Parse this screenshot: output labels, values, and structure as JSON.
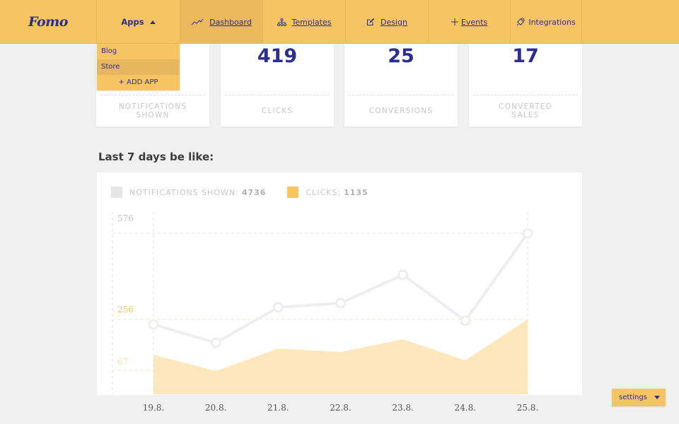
{
  "nav": {
    "logo": "Fomo",
    "apps_label": "Apps",
    "items": [
      {
        "label": "Dashboard",
        "icon": "trend-line-icon",
        "active": true
      },
      {
        "label": "Templates",
        "icon": "sitemap-icon"
      },
      {
        "label": "Design",
        "icon": "edit-icon"
      },
      {
        "label": "Events",
        "icon": "plus-icon"
      },
      {
        "label": "Integrations",
        "icon": "plug-icon"
      }
    ]
  },
  "apps_dropdown": {
    "items": [
      "Blog",
      "Store"
    ],
    "add_label": "+ ADD APP"
  },
  "stats": [
    {
      "value": "",
      "label": "NOTIFICATIONS SHOWN"
    },
    {
      "value": "419",
      "label": "CLICKS"
    },
    {
      "value": "25",
      "label": "CONVERSIONS"
    },
    {
      "value": "17",
      "label": "CONVERTED SALES"
    }
  ],
  "section_title": "Last 7 days be like:",
  "legend": [
    {
      "label": "NOTIFICATIONS SHOWN:",
      "value": "4736",
      "color": "#e6e6e6"
    },
    {
      "label": "CLICKS:",
      "value": "1135",
      "color": "#f7c463"
    }
  ],
  "settings_label": "settings",
  "chart_data": {
    "type": "line",
    "title": "Last 7 days be like:",
    "categories": [
      "19.8.",
      "20.8.",
      "21.8.",
      "22.8.",
      "23.8.",
      "24.8.",
      "25.8."
    ],
    "series": [
      {
        "name": "Notifications shown",
        "style": "line",
        "color": "#eeeeee",
        "values": [
          250,
          184,
          311,
          326,
          427,
          263,
          576
        ],
        "total": 4736,
        "ylim": [
          0,
          576
        ],
        "axis_labels": [
          "576"
        ]
      },
      {
        "name": "Clicks",
        "style": "area",
        "color": "#fde8be",
        "values": [
          125,
          64,
          148,
          135,
          182,
          104,
          256
        ],
        "total": 1135,
        "ylim": [
          0,
          256
        ],
        "axis_labels": [
          "256",
          "67"
        ],
        "axis_label_color": "#f7c463"
      }
    ],
    "grid": true,
    "legend_position": "top-left"
  }
}
